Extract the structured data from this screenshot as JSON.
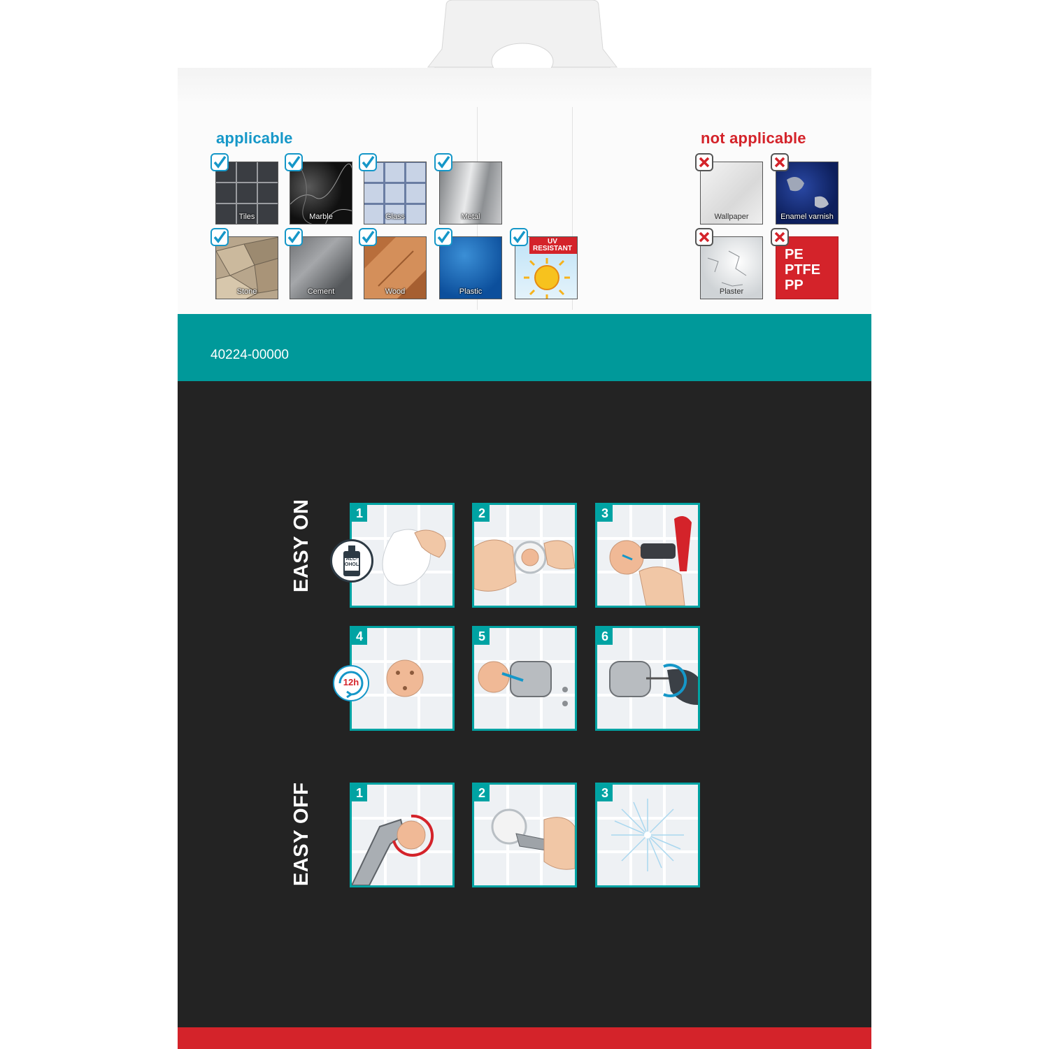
{
  "article_number": "40224-00000",
  "applicable": {
    "title": "applicable",
    "items": [
      {
        "label": "Tiles",
        "icon": "check-icon"
      },
      {
        "label": "Marble",
        "icon": "check-icon"
      },
      {
        "label": "Glass",
        "icon": "check-icon"
      },
      {
        "label": "Metal",
        "icon": "check-icon"
      },
      {
        "label": "Stone",
        "icon": "check-icon"
      },
      {
        "label": "Cement",
        "icon": "check-icon"
      },
      {
        "label": "Wood",
        "icon": "check-icon"
      },
      {
        "label": "Plastic",
        "icon": "check-icon"
      }
    ],
    "uv_badge": "UV RESISTANT"
  },
  "not_applicable": {
    "title": "not applicable",
    "items": [
      {
        "label": "Wallpaper",
        "icon": "cross-icon"
      },
      {
        "label": "Enamel varnish",
        "icon": "cross-icon"
      },
      {
        "label": "Plaster",
        "icon": "cross-icon"
      }
    ],
    "plastics_lines": [
      "PE",
      "PTFE",
      "PP"
    ]
  },
  "easy_on": {
    "title": "EASY ON",
    "steps": [
      "1",
      "2",
      "3",
      "4",
      "5",
      "6"
    ],
    "alcohol_badge_lines": [
      "ALC-",
      "OHOL"
    ],
    "time_badge": "12h"
  },
  "easy_off": {
    "title": "EASY OFF",
    "steps": [
      "1",
      "2",
      "3"
    ]
  },
  "colors": {
    "teal": "#00999a",
    "step_border": "#00a3a3",
    "dark_panel": "#232323",
    "red": "#d4232a",
    "applicable_title": "#1597c8",
    "not_applicable_title": "#d4232a",
    "check": "#1597c8",
    "cross": "#d4232a"
  }
}
